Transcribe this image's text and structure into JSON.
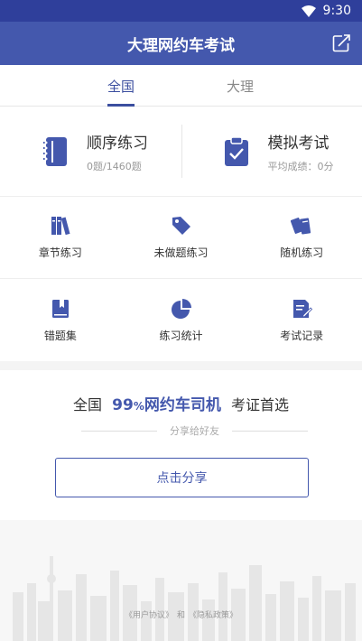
{
  "status_bar": {
    "time": "9:30",
    "icons": [
      "wifi-icon"
    ]
  },
  "header": {
    "title": "大理网约车考试",
    "share_icon": "share-icon"
  },
  "tabs": [
    {
      "label": "全国",
      "active": true
    },
    {
      "label": "大理",
      "active": false
    }
  ],
  "cards": [
    {
      "title": "顺序练习",
      "sub": "0题/1460题",
      "icon": "notebook-icon"
    },
    {
      "title": "模拟考试",
      "sub": "平均成绩：0分",
      "icon": "clipboard-check-icon"
    }
  ],
  "grid": [
    {
      "label": "章节练习",
      "icon": "books-icon"
    },
    {
      "label": "未做题练习",
      "icon": "tag-icon"
    },
    {
      "label": "随机练习",
      "icon": "cards-icon"
    },
    {
      "label": "错题集",
      "icon": "bookmark-book-icon"
    },
    {
      "label": "练习统计",
      "icon": "pie-chart-icon"
    },
    {
      "label": "考试记录",
      "icon": "document-edit-icon"
    }
  ],
  "promo": {
    "prefix": "全国",
    "percent_number": "99",
    "percent_sign": "%",
    "highlight": "网约车司机",
    "suffix": "考证首选",
    "divider_text": "分享给好友",
    "button_label": "点击分享"
  },
  "legal": {
    "user_agreement": "《用户协议》",
    "and": "和",
    "privacy_policy": "《隐私政策》"
  },
  "colors": {
    "primary": "#4458ad",
    "status_bar": "#2f3f9b"
  }
}
